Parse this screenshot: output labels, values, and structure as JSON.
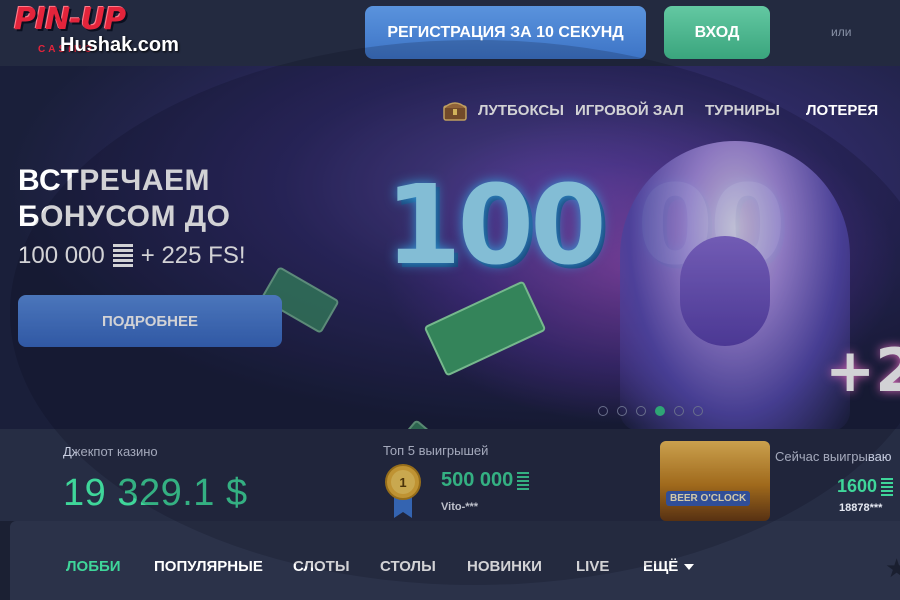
{
  "header": {
    "logo_text": "PIN-UP",
    "logo_sub": "CASINO",
    "watermark": "Hushak.com",
    "register_label": "РЕГИСТРАЦИЯ ЗА 10 СЕКУНД",
    "login_label": "ВХОД",
    "or_text": "или"
  },
  "menu": {
    "items": [
      "ЛУТБОКСЫ",
      "ИГРОВОЙ ЗАЛ",
      "ТУРНИРЫ",
      "ЛОТЕРЕЯ"
    ]
  },
  "hero": {
    "title_line1": "ВСТРЕЧАЕМ",
    "title_line2": "БОНУСОМ ДО",
    "amount": "100 000",
    "bonus_rest": "+ 225 FS!",
    "more_label": "ПОДРОБНЕЕ",
    "big_digits": "100 00",
    "plus_digits": "+2",
    "slides_total": 6,
    "active_slide": 4
  },
  "stats": {
    "jackpot_label": "Джекпот казино",
    "jackpot_value": "19 329.1 $",
    "top5_label": "Топ 5 выигрышей",
    "top5_rank": "1",
    "top5_amount": "500 000",
    "top5_user": "Vito-***",
    "now_label": "Сейчас выигрываю",
    "now_game": "BEER O'CLOCK",
    "now_amount": "1600",
    "now_user": "18878***"
  },
  "categories": {
    "items": [
      "ЛОББИ",
      "ПОПУЛЯРНЫЕ",
      "СЛОТЫ",
      "СТОЛЫ",
      "НОВИНКИ",
      "LIVE"
    ],
    "more_label": "ЕЩЁ",
    "active": "ЛОББИ"
  },
  "colors": {
    "accent_green": "#3fd69a",
    "register_blue": "#4a82d2",
    "login_green": "#4cb78e",
    "header_bg": "#232a40"
  }
}
